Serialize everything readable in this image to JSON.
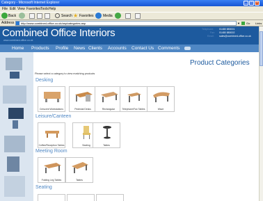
{
  "window": {
    "title": "Category - Microsoft Internet Explorer"
  },
  "menu": [
    "File",
    "Edit",
    "View",
    "Favorites",
    "Tools",
    "Help"
  ],
  "toolbar": {
    "back_label": "Back",
    "search_label": "Search",
    "favorites_label": "Favorites",
    "media_label": "Media"
  },
  "address": {
    "label": "Address",
    "url": "http://www.combined-office.co.uk/asp/categories.asp",
    "go_label": "Go",
    "links_label": "Links"
  },
  "site": {
    "title": "Combined Office Interiors",
    "url": "www.combined-office.co.uk",
    "contact": {
      "telephone_label": "Telephone:",
      "telephone": "01480 880001",
      "fax_label": "Fax:",
      "fax": "01480 880002",
      "email_label": "Email:",
      "email": "sales@combined-office.co.uk"
    }
  },
  "nav": [
    "Home",
    "Products",
    "Profile",
    "News",
    "Clients",
    "Accounts",
    "Contact Us",
    "Comments"
  ],
  "page": {
    "heading": "Product Categories",
    "intro": "Please select a category to view matching products"
  },
  "sections": {
    "desking": {
      "title": "Desking",
      "items": [
        "Crescent Workstations",
        "Pedestal Desks",
        "Rectangular",
        "Telephone/Fax Tables",
        "Wave"
      ]
    },
    "leisure": {
      "title": "Leisure/Canteen",
      "items": [
        "Coffee/Reception Tables",
        "Seating",
        "Tables"
      ]
    },
    "meeting": {
      "title": "Meeting Room",
      "items": [
        "Folding Leg Tables",
        "Tables"
      ]
    },
    "seating": {
      "title": "Seating"
    }
  },
  "colors": {
    "header": "#1d5a9e",
    "nav": "#4f87c4",
    "sidebar": "#dbe5f0",
    "section_title": "#4f87c4"
  }
}
